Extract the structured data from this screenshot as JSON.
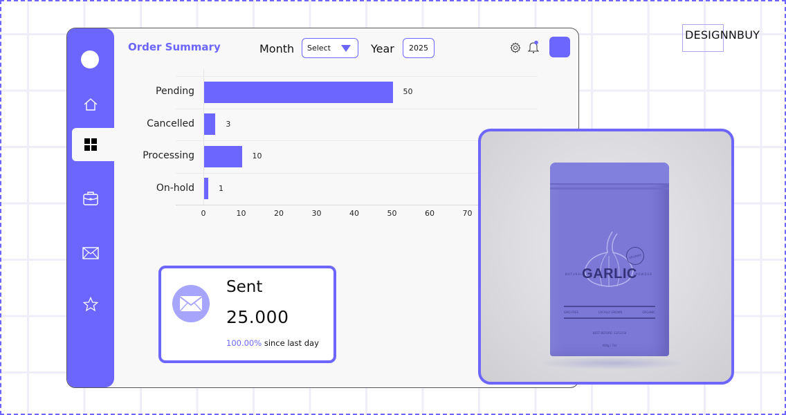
{
  "brand": {
    "logo_text": "DESIGNNBUY"
  },
  "header": {
    "title": "Order Summary",
    "month_label": "Month",
    "month_select_value": "Select",
    "year_label": "Year",
    "year_value": "2025",
    "icons": [
      "gear-icon",
      "bell-icon",
      "user-avatar"
    ]
  },
  "sidebar": {
    "items": [
      {
        "name": "home",
        "icon": "home-icon",
        "active": false
      },
      {
        "name": "dashboard",
        "icon": "grid-icon",
        "active": true
      },
      {
        "name": "briefcase",
        "icon": "briefcase-icon",
        "active": false
      },
      {
        "name": "mail",
        "icon": "mail-icon",
        "active": false
      },
      {
        "name": "favorites",
        "icon": "star-icon",
        "active": false
      }
    ]
  },
  "chart_data": {
    "type": "bar",
    "orientation": "horizontal",
    "categories": [
      "Pending",
      "Cancelled",
      "Processing",
      "On-hold"
    ],
    "values": [
      50,
      3,
      10,
      1
    ],
    "value_labels": [
      "50",
      "3",
      "10",
      "1"
    ],
    "xlim": [
      0,
      70
    ],
    "x_ticks": [
      0,
      10,
      20,
      30,
      40,
      50,
      60,
      70
    ],
    "x_tick_labels": [
      "0",
      "10",
      "20",
      "30",
      "40",
      "50",
      "60",
      "70"
    ],
    "title": "",
    "xlabel": "",
    "ylabel": "",
    "grid": true,
    "bar_color": "#6c66ff"
  },
  "stat_card": {
    "icon": "mail-icon",
    "title": "Sent",
    "value": "25.000",
    "change_pct": "100.00%",
    "change_text": "since last day"
  },
  "product": {
    "brand_word": "GARLIC",
    "side_left": "NATURAL",
    "side_right": "POWDER",
    "band_items": [
      "GMO FREE",
      "LOCALLY GROWN",
      "ORGANIC"
    ],
    "best_before": "BEST BEFORE: 12/12/18",
    "weight": "400g / 7oz",
    "stamp": "ORGANIC"
  },
  "colors": {
    "accent": "#6c66ff",
    "accent_light": "#a6a4fb",
    "panel_bg": "#f8f8f8"
  }
}
